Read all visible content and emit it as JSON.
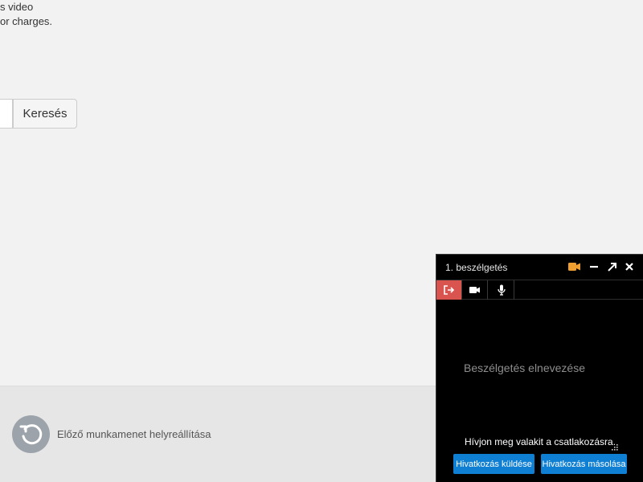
{
  "intro": {
    "line1": "s video",
    "line2": "or charges."
  },
  "search": {
    "button_label": "Keresés",
    "input_value": ""
  },
  "restore": {
    "label": "Előző munkamenet helyreállítása",
    "icon": "restore-icon"
  },
  "chat": {
    "title": "1. beszélgetés",
    "header_icons": [
      "camera-icon",
      "minimize-icon",
      "expand-icon",
      "close-icon"
    ],
    "toolbar_icons": [
      "leave-icon",
      "video-icon",
      "microphone-icon"
    ],
    "name_placeholder": "Beszélgetés elnevezése",
    "invite_text": "Hívjon meg valakit a csatlakozásra.",
    "send_link_label": "Hivatkozás küldése",
    "copy_link_label": "Hivatkozás másolása"
  },
  "colors": {
    "accent_orange": "#f0a030",
    "leave_red": "#d9534f",
    "link_blue": "#0f7fd4",
    "widget_bg": "#000000",
    "page_bg": "#f2f2f2"
  }
}
